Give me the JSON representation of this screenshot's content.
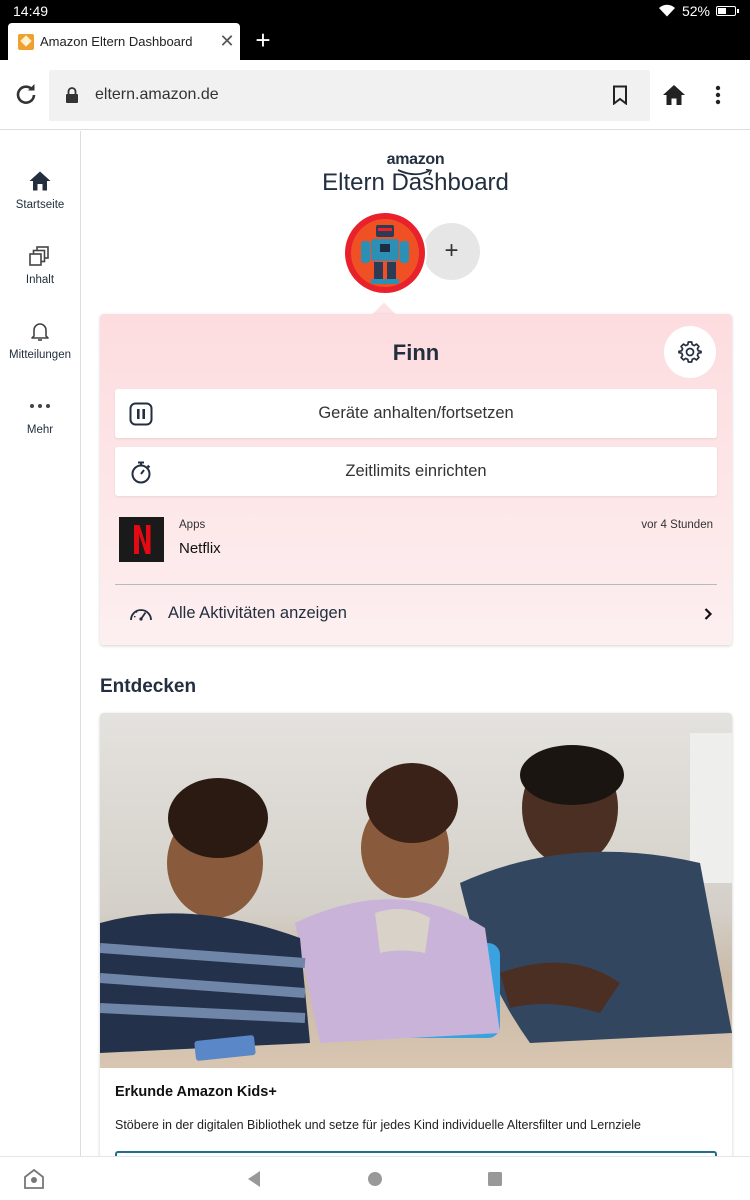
{
  "status_bar": {
    "time": "14:49",
    "battery": "52%",
    "battery_level": 0.52
  },
  "browser": {
    "tab_title": "Amazon Eltern Dashboard",
    "url": "eltern.amazon.de"
  },
  "sidebar": {
    "items": [
      {
        "label": "Startseite",
        "icon": "home-icon"
      },
      {
        "label": "Inhalt",
        "icon": "content-icon"
      },
      {
        "label": "Mitteilungen",
        "icon": "bell-icon"
      },
      {
        "label": "Mehr",
        "icon": "more-icon"
      }
    ]
  },
  "header": {
    "logo_text": "amazon",
    "title": "Eltern Dashboard"
  },
  "profile": {
    "name": "Finn",
    "actions": [
      {
        "label": "Geräte anhalten/fortsetzen",
        "icon": "pause-icon"
      },
      {
        "label": "Zeitlimits einrichten",
        "icon": "stopwatch-icon"
      }
    ],
    "activity": {
      "category": "Apps",
      "title": "Netflix",
      "time": "vor 4 Stunden"
    },
    "all_activities_label": "Alle Aktivitäten anzeigen"
  },
  "discover": {
    "section_title": "Entdecken",
    "card_title": "Erkunde Amazon Kids+",
    "card_text": "Stöbere in der digitalen Bibliothek und setze für jedes Kind individuelle Altersfilter und Lernziele"
  },
  "colors": {
    "brand_dark": "#232f3e",
    "card_pink": "#fddcdf",
    "avatar_red": "#e8212b",
    "accent_teal": "#1f6f8b"
  }
}
